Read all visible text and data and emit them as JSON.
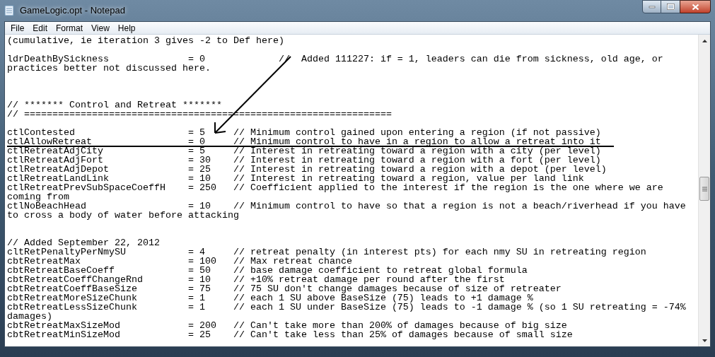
{
  "window": {
    "title": "GameLogic.opt - Notepad"
  },
  "menu": [
    "File",
    "Edit",
    "Format",
    "View",
    "Help"
  ],
  "lines": [
    {
      "kind": "text",
      "text": "(cumulative, ie iteration 3 gives -2 to Def here)"
    },
    {
      "kind": "blank"
    },
    {
      "kind": "text",
      "text": "ldrDeathBySickness              = 0             //  Added 111227: if = 1, leaders can die from sickness, old age, or"
    },
    {
      "kind": "text",
      "text": "practices better not discussed here."
    },
    {
      "kind": "blank"
    },
    {
      "kind": "blank"
    },
    {
      "kind": "blank"
    },
    {
      "kind": "text",
      "text": "// ******* Control and Retreat *******"
    },
    {
      "kind": "text",
      "text": "// ================================================================="
    },
    {
      "kind": "blank"
    },
    {
      "kind": "text",
      "text": "ctlContested                    = 5     // Minimum control gained upon entering a region (if not passive)"
    },
    {
      "kind": "text",
      "text": "ctlAllowRetreat                 = 0     // Minimum control to have in a region to allow a retreat into it"
    },
    {
      "kind": "text",
      "text": "ctlRetreatAdjCity               = 5     // Interest in retreating toward a region with a city (per level)"
    },
    {
      "kind": "text",
      "text": "ctlRetreatAdjFort               = 30    // Interest in retreating toward a region with a fort (per level)"
    },
    {
      "kind": "text",
      "text": "ctlRetreatAdjDepot              = 25    // Interest in retreating toward a region with a depot (per level)"
    },
    {
      "kind": "text",
      "text": "ctlRetreatLandLink              = 10    // Interest in retreating toward a region, value per land link"
    },
    {
      "kind": "text",
      "text": "ctlRetreatPrevSubSpaceCoeffH    = 250   // Coefficient applied to the interest if the region is the one where we are"
    },
    {
      "kind": "text",
      "text": "coming from"
    },
    {
      "kind": "text",
      "text": "ctlNoBeachHead                  = 10    // Minimum control to have so that a region is not a beach/riverhead if you have"
    },
    {
      "kind": "text",
      "text": "to cross a body of water before attacking"
    },
    {
      "kind": "blank"
    },
    {
      "kind": "blank"
    },
    {
      "kind": "text",
      "text": "// Added September 22, 2012"
    },
    {
      "kind": "text",
      "text": "cltRetPenaltyPerNmySU           = 4     // retreat penalty (in interest pts) for each nmy SU in retreating region"
    },
    {
      "kind": "text",
      "text": "cbtRetreatMax                   = 100   // Max retreat chance"
    },
    {
      "kind": "text",
      "text": "cbtRetreatBaseCoeff             = 50    // base damage coefficient to retreat global formula"
    },
    {
      "kind": "text",
      "text": "cbtRetreatCoeffChangeRnd        = 10    // +10% retreat damage per round after the first"
    },
    {
      "kind": "text",
      "text": "cbtRetreatCoeffBaseSize         = 75    // 75 SU don't change damages because of size of retreater"
    },
    {
      "kind": "text",
      "text": "cbtRetreatMoreSizeChunk         = 1     // each 1 SU above BaseSize (75) leads to +1 damage %"
    },
    {
      "kind": "text",
      "text": "cbtRetreatLessSizeChunk         = 1     // each 1 SU under BaseSize (75) leads to -1 damage % (so 1 SU retreating = -74%"
    },
    {
      "kind": "text",
      "text": "damages)"
    },
    {
      "kind": "text",
      "text": "cbtRetreatMaxSizeMod            = 200   // Can't take more than 200% of damages because of big size"
    },
    {
      "kind": "text",
      "text": "cbtRetreatMinSizeMod            = 25    // Can't take less than 25% of damages because of small size"
    }
  ]
}
